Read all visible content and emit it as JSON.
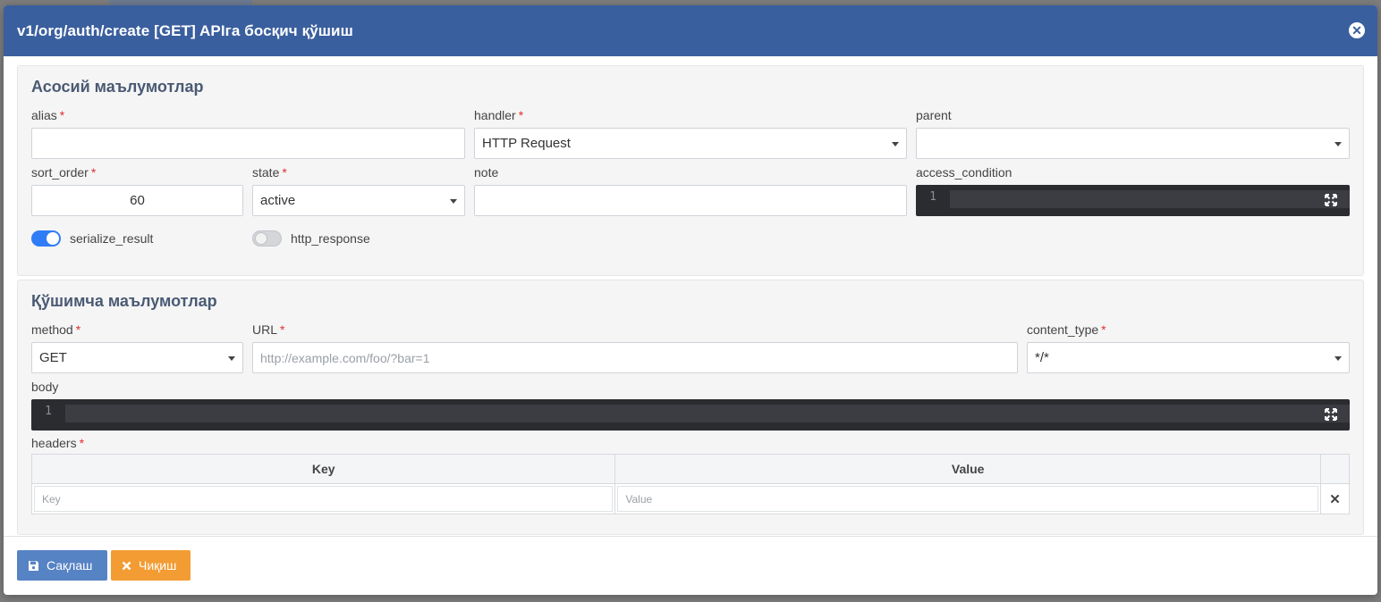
{
  "modal": {
    "title": "v1/org/auth/create [GET] APIга босқич қўшиш",
    "close_glyph": "✕"
  },
  "main_section": {
    "title": "Асосий маълумотлар",
    "fields": {
      "alias": {
        "label": "alias",
        "value": ""
      },
      "handler": {
        "label": "handler",
        "value": "HTTP Request"
      },
      "parent": {
        "label": "parent",
        "value": ""
      },
      "sort_order": {
        "label": "sort_order",
        "value": "60"
      },
      "state": {
        "label": "state",
        "value": "active"
      },
      "note": {
        "label": "note",
        "value": ""
      },
      "access_condition": {
        "label": "access_condition",
        "line_number": "1"
      }
    },
    "toggles": {
      "serialize_result": {
        "label": "serialize_result",
        "on": true
      },
      "http_response": {
        "label": "http_response",
        "on": false
      }
    }
  },
  "extra_section": {
    "title": "Қўшимча маълумотлар",
    "fields": {
      "method": {
        "label": "method",
        "value": "GET"
      },
      "url": {
        "label": "URL",
        "placeholder": "http://example.com/foo/?bar=1"
      },
      "content_type": {
        "label": "content_type",
        "value": "*/*"
      },
      "body": {
        "label": "body",
        "line_number": "1"
      },
      "headers": {
        "label": "headers",
        "columns": [
          "Key",
          "Value"
        ],
        "row": {
          "key_placeholder": "Key",
          "value_placeholder": "Value"
        },
        "remove_glyph": "✕"
      }
    }
  },
  "required_mark": "*",
  "footer": {
    "save_label": "Сақлаш",
    "exit_label": "Чиқиш"
  },
  "colors": {
    "header": "#3a5f9e",
    "save": "#5683c4",
    "exit": "#f39c33",
    "toggle_on": "#2f7cf6"
  }
}
